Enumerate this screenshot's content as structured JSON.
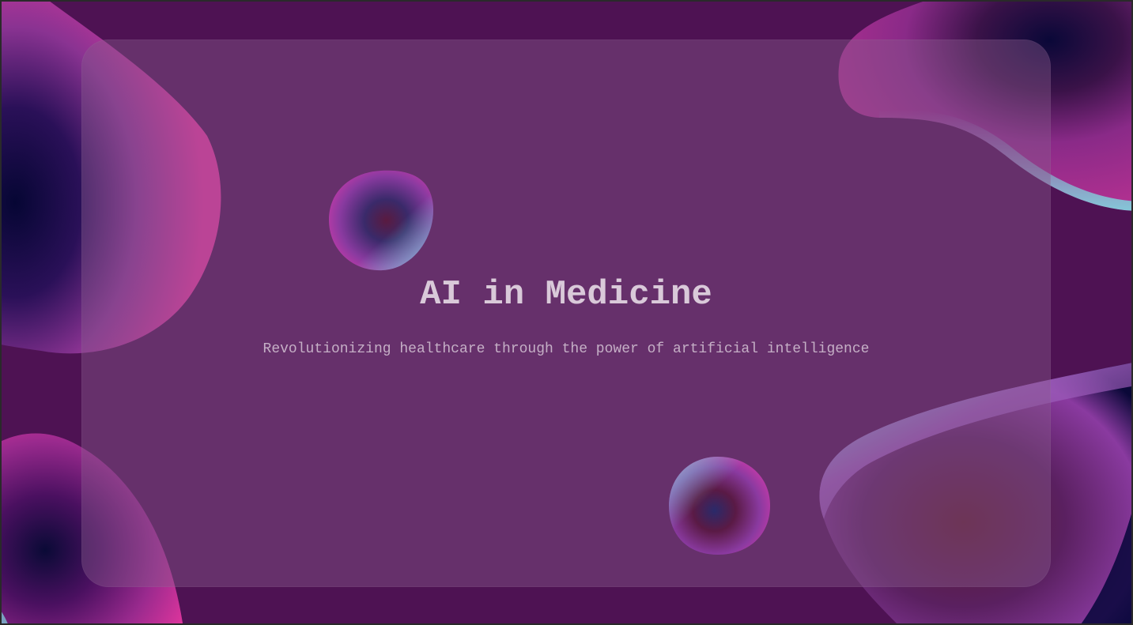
{
  "slide": {
    "title": "AI in Medicine",
    "subtitle": "Revolutionizing healthcare through the power of artificial intelligence"
  },
  "colors": {
    "background": "#4e1253",
    "panel": "rgba(135, 90, 140, 0.42)",
    "title_text": "#d9c9d9",
    "subtitle_text": "#c5afc6",
    "blob_pink": "#e0359d",
    "blob_navy": "#0a0a3c",
    "blob_cyan": "#7fd8e0",
    "blob_purple": "#7b2a8e"
  }
}
